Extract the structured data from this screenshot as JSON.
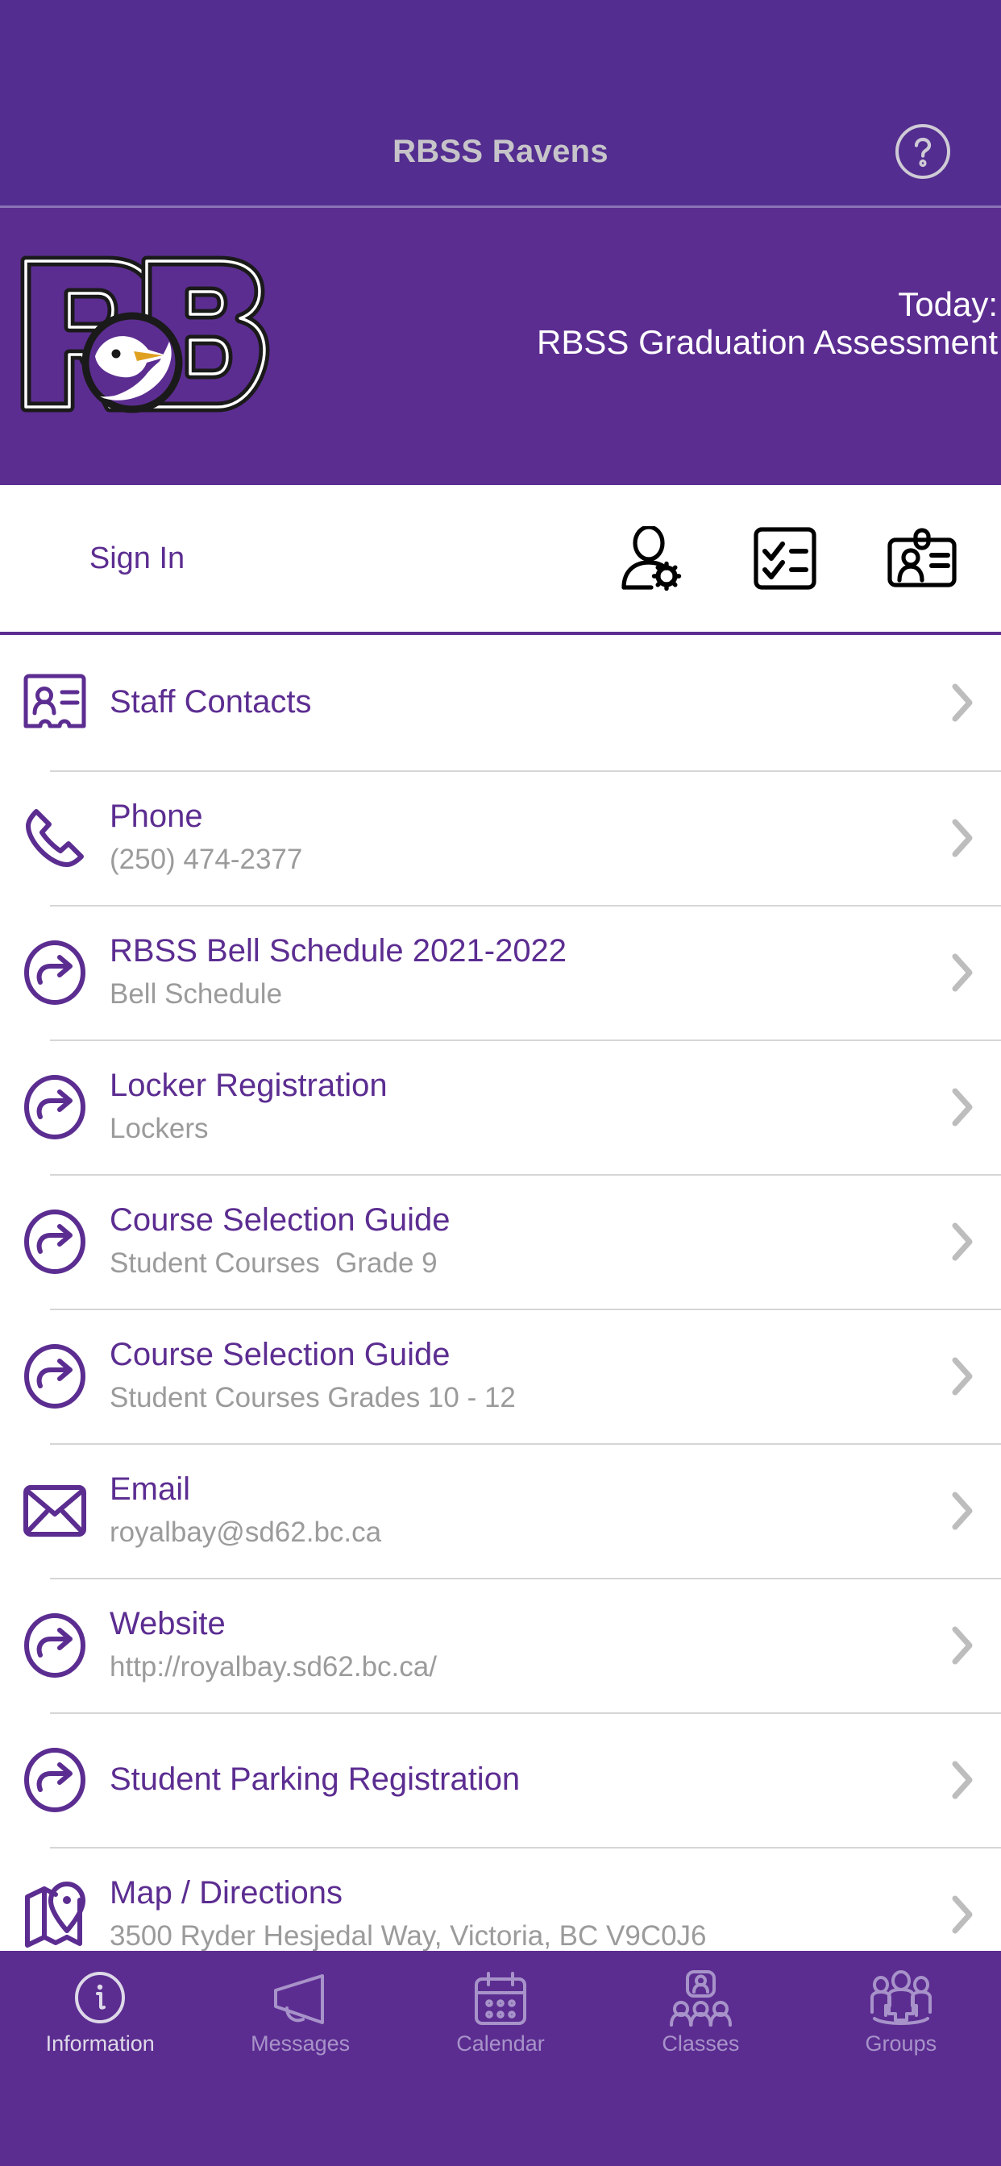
{
  "navbar": {
    "title": "RBSS Ravens",
    "help_icon": "help-circle-icon"
  },
  "banner": {
    "logo_alt": "RB Ravens logo",
    "today_label": "Today:",
    "today_event": "RBSS Graduation Assessment"
  },
  "toolbar": {
    "sign_in_label": "Sign In",
    "icons": [
      {
        "name": "user-settings-icon"
      },
      {
        "name": "checklist-icon"
      },
      {
        "name": "id-badge-icon"
      }
    ]
  },
  "list": {
    "items": [
      {
        "icon": "contact-card-icon",
        "title": "Staff Contacts",
        "subtitle": ""
      },
      {
        "icon": "phone-icon",
        "title": "Phone",
        "subtitle": "(250) 474-2377"
      },
      {
        "icon": "link-arrow-icon",
        "title": "RBSS Bell Schedule 2021-2022",
        "subtitle": "Bell Schedule"
      },
      {
        "icon": "link-arrow-icon",
        "title": "Locker Registration",
        "subtitle": "Lockers"
      },
      {
        "icon": "link-arrow-icon",
        "title": "Course Selection Guide",
        "subtitle": "Student Courses  Grade 9"
      },
      {
        "icon": "link-arrow-icon",
        "title": "Course Selection Guide",
        "subtitle": "Student Courses Grades 10 - 12"
      },
      {
        "icon": "envelope-icon",
        "title": "Email",
        "subtitle": "royalbay@sd62.bc.ca"
      },
      {
        "icon": "link-arrow-icon",
        "title": "Website",
        "subtitle": "http://royalbay.sd62.bc.ca/"
      },
      {
        "icon": "link-arrow-icon",
        "title": "Student Parking Registration",
        "subtitle": ""
      },
      {
        "icon": "map-pin-icon",
        "title": "Map / Directions",
        "subtitle": "3500 Ryder Hesjedal Way, Victoria, BC V9C0J6"
      }
    ]
  },
  "tabbar": {
    "tabs": [
      {
        "label": "Information",
        "icon": "info-circle-icon",
        "active": true
      },
      {
        "label": "Messages",
        "icon": "megaphone-icon",
        "active": false
      },
      {
        "label": "Calendar",
        "icon": "calendar-icon",
        "active": false
      },
      {
        "label": "Classes",
        "icon": "classes-icon",
        "active": false
      },
      {
        "label": "Groups",
        "icon": "groups-icon",
        "active": false
      }
    ]
  },
  "colors": {
    "brand_purple": "#5c2d91",
    "navbar_purple": "#532d8f",
    "link_purple": "#5c2d91",
    "subtitle_gray": "#9b9b9b",
    "chevron_gray": "#bdbdbd",
    "navbar_title_gray": "#c6c4c9",
    "tab_inactive": "#a793c9",
    "tab_active": "#ded9e8"
  }
}
